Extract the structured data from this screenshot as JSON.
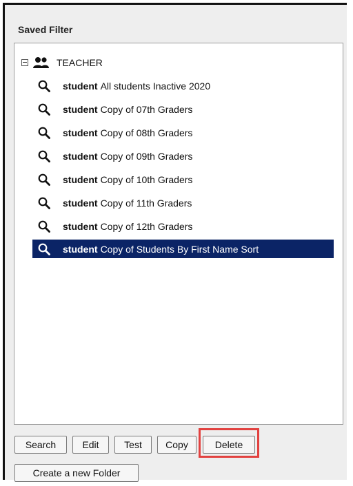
{
  "panel": {
    "title": "Saved Filter"
  },
  "tree": {
    "root": {
      "label": "TEACHER",
      "toggle_icon": "collapse-minus-icon",
      "icon": "user-group-icon"
    },
    "items": [
      {
        "type": "student",
        "name": "All students Inactive 2020"
      },
      {
        "type": "student",
        "name": "Copy of 07th Graders"
      },
      {
        "type": "student",
        "name": "Copy of 08th Graders"
      },
      {
        "type": "student",
        "name": "Copy of 09th Graders"
      },
      {
        "type": "student",
        "name": "Copy of 10th Graders"
      },
      {
        "type": "student",
        "name": "Copy of 11th Graders"
      },
      {
        "type": "student",
        "name": "Copy of 12th Graders"
      },
      {
        "type": "student",
        "name": "Copy of Students By First Name Sort",
        "selected": true
      }
    ]
  },
  "buttons": {
    "search": "Search",
    "edit": "Edit",
    "test": "Test",
    "copy": "Copy",
    "delete": "Delete",
    "create_folder": "Create a new Folder"
  },
  "colors": {
    "selected_bg": "#0b2466",
    "highlight": "#e2413f"
  }
}
